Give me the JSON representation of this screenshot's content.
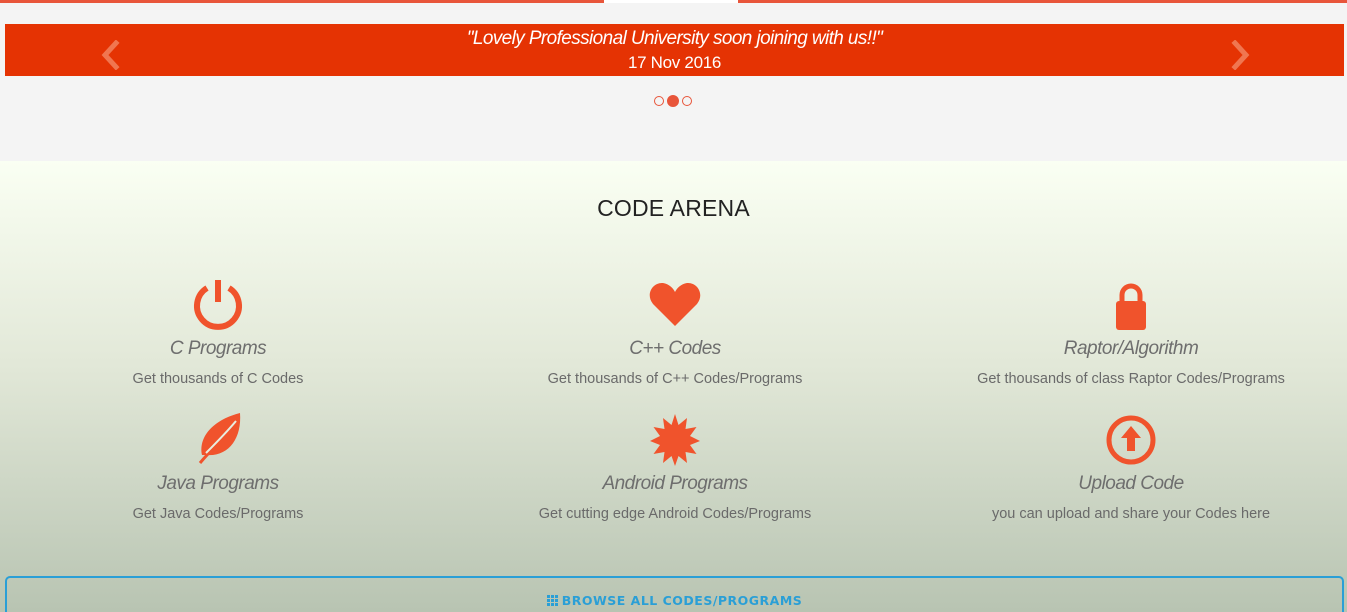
{
  "slider": {
    "quote": "\"Lovely Professional University soon joining with us!!\"",
    "date": "17 Nov 2016",
    "prev_icon": "chevron-left-icon",
    "next_icon": "chevron-right-icon",
    "slide_count": 3,
    "active_slide": 2
  },
  "arena": {
    "title": "CODE ARENA",
    "features": [
      {
        "icon": "power-icon",
        "name": "C Programs",
        "desc": "Get thousands of C Codes"
      },
      {
        "icon": "heart-icon",
        "name": "C++ Codes",
        "desc": "Get thousands of C++ Codes/Programs"
      },
      {
        "icon": "lock-icon",
        "name": "Raptor/Algorithm",
        "desc": "Get thousands of class Raptor Codes/Programs"
      },
      {
        "icon": "leaf-icon",
        "name": "Java Programs",
        "desc": "Get Java Codes/Programs"
      },
      {
        "icon": "certificate-icon",
        "name": "Android Programs",
        "desc": "Get cutting edge Android Codes/Programs"
      },
      {
        "icon": "upload-icon",
        "name": "Upload Code",
        "desc": "you can upload and share your Codes here"
      }
    ],
    "browse_label": "BROWSE ALL CODES/PROGRAMS",
    "browse_icon": "grid-icon"
  },
  "colors": {
    "accent": "#e8553a",
    "banner": "#e53303",
    "link": "#2a9fd6"
  }
}
